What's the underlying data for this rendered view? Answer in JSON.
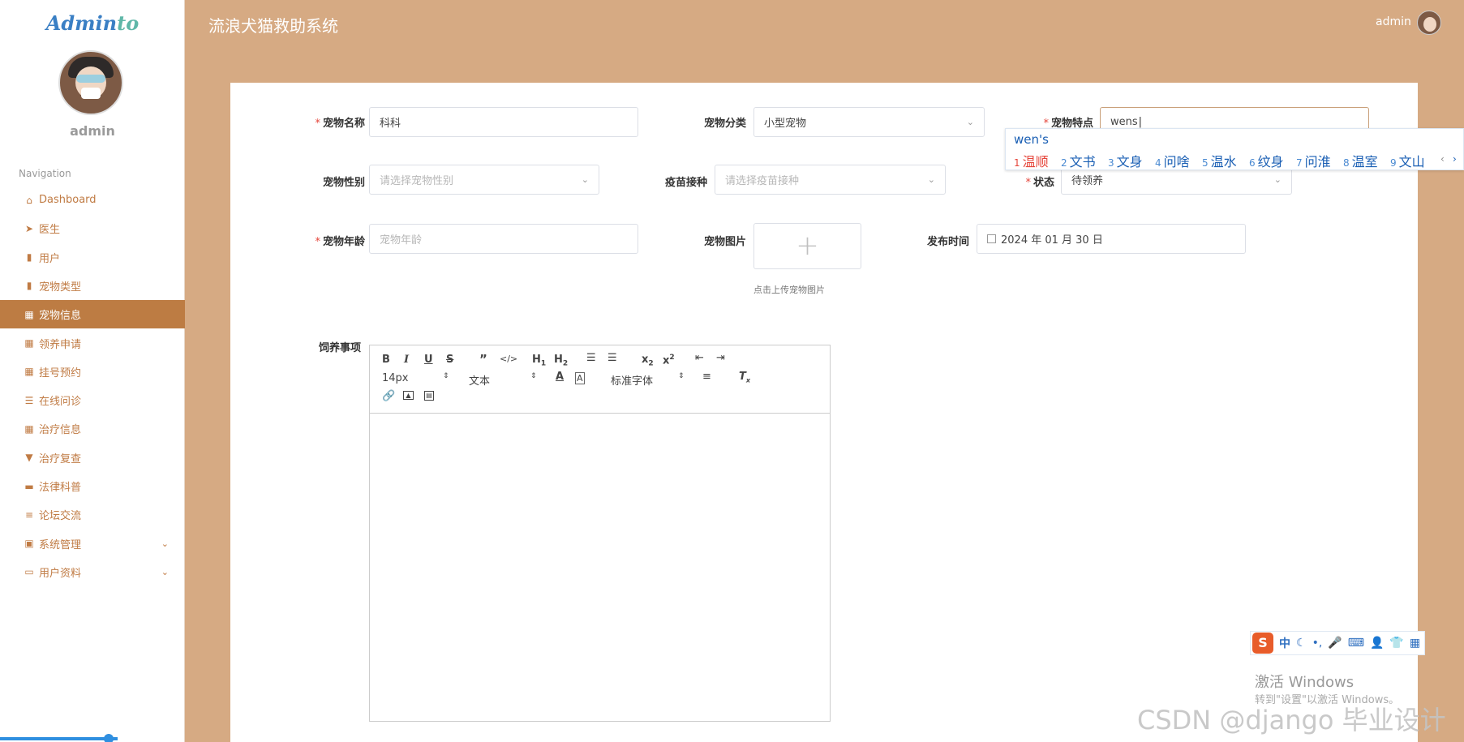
{
  "sidebar": {
    "logo_main": "Admin",
    "logo_tail": "to",
    "username": "admin",
    "nav_label": "Navigation",
    "items": [
      {
        "icon": "home-icon",
        "glyph": "⌂",
        "label": "Dashboard"
      },
      {
        "icon": "send-icon",
        "glyph": "➤",
        "label": "医生"
      },
      {
        "icon": "bar-chart-icon",
        "glyph": "▮",
        "label": "用户"
      },
      {
        "icon": "book-icon",
        "glyph": "▮",
        "label": "宠物类型"
      },
      {
        "icon": "grid-icon",
        "glyph": "▦",
        "label": "宠物信息"
      },
      {
        "icon": "grid-icon",
        "glyph": "▦",
        "label": "领养申请"
      },
      {
        "icon": "grid-icon",
        "glyph": "▦",
        "label": "挂号预约"
      },
      {
        "icon": "sliders-icon",
        "glyph": "☰",
        "label": "在线问诊"
      },
      {
        "icon": "grid-icon",
        "glyph": "▦",
        "label": "治疗信息"
      },
      {
        "icon": "flag-icon",
        "glyph": "▼",
        "label": "治疗复查"
      },
      {
        "icon": "ticket-icon",
        "glyph": "▬",
        "label": "法律科普"
      },
      {
        "icon": "list-icon",
        "glyph": "≡",
        "label": "论坛交流"
      },
      {
        "icon": "clipboard-icon",
        "glyph": "▣",
        "label": "系统管理"
      },
      {
        "icon": "id-card-icon",
        "glyph": "▭",
        "label": "用户资料"
      }
    ],
    "active_item": "宠物信息"
  },
  "header": {
    "title": "流浪犬猫救助系统",
    "user": "admin"
  },
  "form": {
    "pet_name": {
      "label": "宠物名称",
      "value": "科科"
    },
    "pet_category": {
      "label": "宠物分类",
      "value": "小型宠物"
    },
    "pet_feature": {
      "label": "宠物特点",
      "value": "wens"
    },
    "pet_gender": {
      "label": "宠物性别",
      "placeholder": "请选择宠物性别"
    },
    "vaccine": {
      "label": "疫苗接种",
      "placeholder": "请选择疫苗接种"
    },
    "status": {
      "label": "状态",
      "value": "待领养"
    },
    "pet_age": {
      "label": "宠物年龄",
      "placeholder": "宠物年龄"
    },
    "pet_image": {
      "label": "宠物图片",
      "plus": "+",
      "hint": "点击上传宠物图片"
    },
    "publish_time": {
      "label": "发布时间",
      "value": "2024 年 01 月 30 日"
    },
    "care_notes": {
      "label": "饲养事项"
    }
  },
  "editor": {
    "font_size": "14px",
    "paragraph": "文本",
    "font_family": "标准字体",
    "tools": [
      "bold",
      "italic",
      "underline",
      "strike",
      "blockquote",
      "code",
      "h1",
      "h2",
      "ordered-list",
      "bullet-list",
      "subscript",
      "superscript",
      "outdent",
      "indent",
      "font-color",
      "background-color",
      "align",
      "clean",
      "link",
      "image",
      "video"
    ]
  },
  "ime": {
    "composition": "wen's",
    "candidates": [
      {
        "n": "1",
        "t": "温顺"
      },
      {
        "n": "2",
        "t": "文书"
      },
      {
        "n": "3",
        "t": "文身"
      },
      {
        "n": "4",
        "t": "问啥"
      },
      {
        "n": "5",
        "t": "温水"
      },
      {
        "n": "6",
        "t": "纹身"
      },
      {
        "n": "7",
        "t": "问淮"
      },
      {
        "n": "8",
        "t": "温室"
      },
      {
        "n": "9",
        "t": "文山"
      }
    ],
    "toolbar_mode": "中"
  },
  "watermark": {
    "activate": "激活 Windows",
    "activate_sub": "转到\"设置\"以激活 Windows。",
    "csdn": "CSDN @django 毕业设计"
  },
  "colors": {
    "accent": "#bd7c43",
    "header_bg": "#d6aa83",
    "required": "#e5453b"
  }
}
